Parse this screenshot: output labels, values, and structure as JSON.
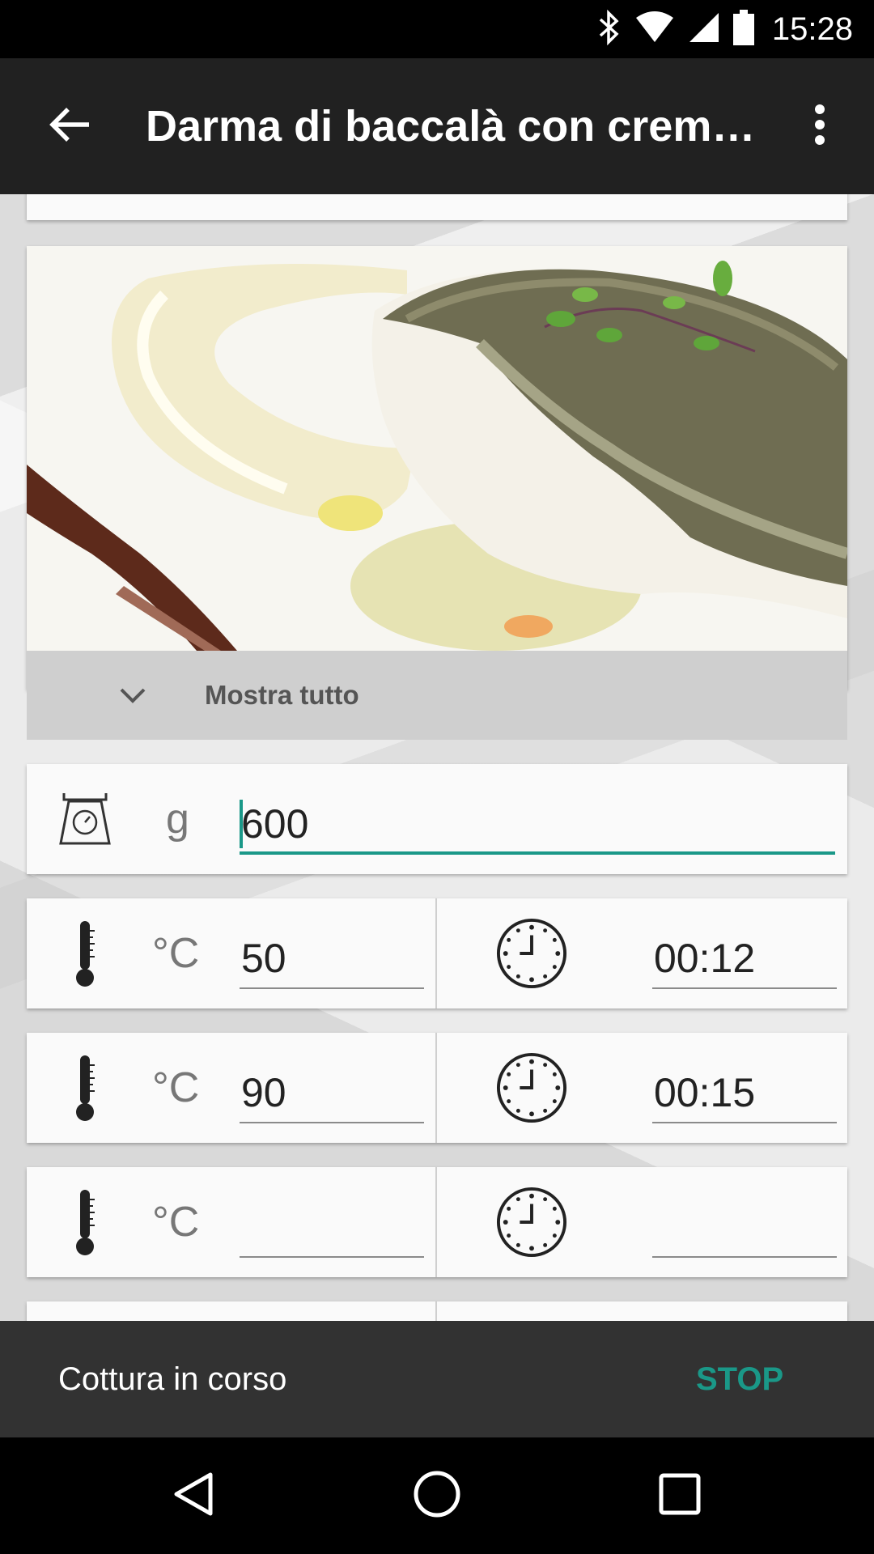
{
  "status_bar": {
    "time": "15:28",
    "icons": [
      "bluetooth-icon",
      "wifi-icon",
      "signal-icon",
      "battery-icon"
    ]
  },
  "app_bar": {
    "title": "Darma di baccalà con crem…",
    "back_icon": "arrow-back-icon",
    "menu_icon": "more-vert-icon"
  },
  "recipe": {
    "photo_alt": "cod-fillet-photo",
    "show_all_label": "Mostra tutto"
  },
  "weight": {
    "unit": "g",
    "value": "600",
    "icon": "scale-icon"
  },
  "cooking_steps": [
    {
      "temp_unit": "°C",
      "temp_value": "50",
      "time_value": "00:12"
    },
    {
      "temp_unit": "°C",
      "temp_value": "90",
      "time_value": "00:15"
    },
    {
      "temp_unit": "°C",
      "temp_value": "",
      "time_value": ""
    }
  ],
  "snackbar": {
    "message": "Cottura in corso",
    "action": "STOP"
  },
  "nav_bar": {
    "buttons": [
      "back-triangle-icon",
      "home-circle-icon",
      "recents-square-icon"
    ]
  },
  "colors": {
    "accent": "#1a9888",
    "app_bar": "#212121",
    "snackbar": "#323232"
  }
}
